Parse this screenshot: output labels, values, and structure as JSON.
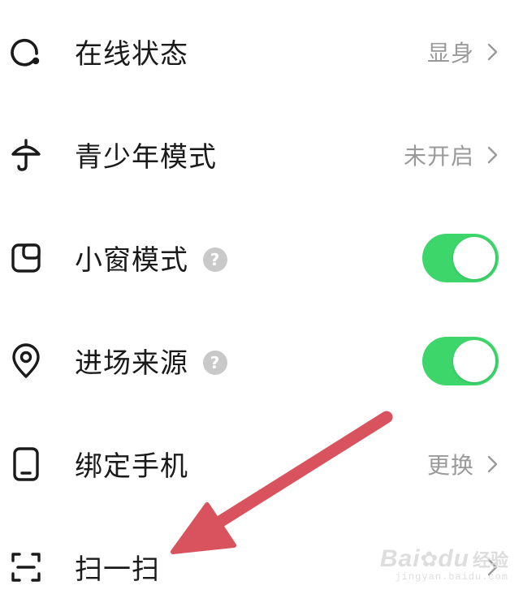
{
  "settings": {
    "rows": [
      {
        "label": "在线状态",
        "value": "显身",
        "icon": "online-status-icon",
        "control": "chevron"
      },
      {
        "label": "青少年模式",
        "value": "未开启",
        "icon": "umbrella-icon",
        "control": "chevron"
      },
      {
        "label": "小窗模式",
        "icon": "mini-window-icon",
        "control": "toggle",
        "toggle_on": true,
        "help": true
      },
      {
        "label": "进场来源",
        "icon": "location-pin-icon",
        "control": "toggle",
        "toggle_on": true,
        "help": true
      },
      {
        "label": "绑定手机",
        "value": "更换",
        "icon": "phone-icon",
        "control": "chevron"
      },
      {
        "label": "扫一扫",
        "icon": "scan-icon",
        "control": "chevron"
      }
    ],
    "help_glyph": "?"
  },
  "annotation": {
    "arrow_color": "#d9535f",
    "target": "扫一扫"
  },
  "watermark": {
    "brand": "Bai",
    "brand2": "du",
    "jingyan": "经验",
    "url": "jingyan.baidu.com"
  },
  "colors": {
    "toggle_on": "#3dd66b",
    "value_text": "#9a9a9a",
    "label_text": "#1a1a1a",
    "help_icon": "#c9c9c9"
  }
}
